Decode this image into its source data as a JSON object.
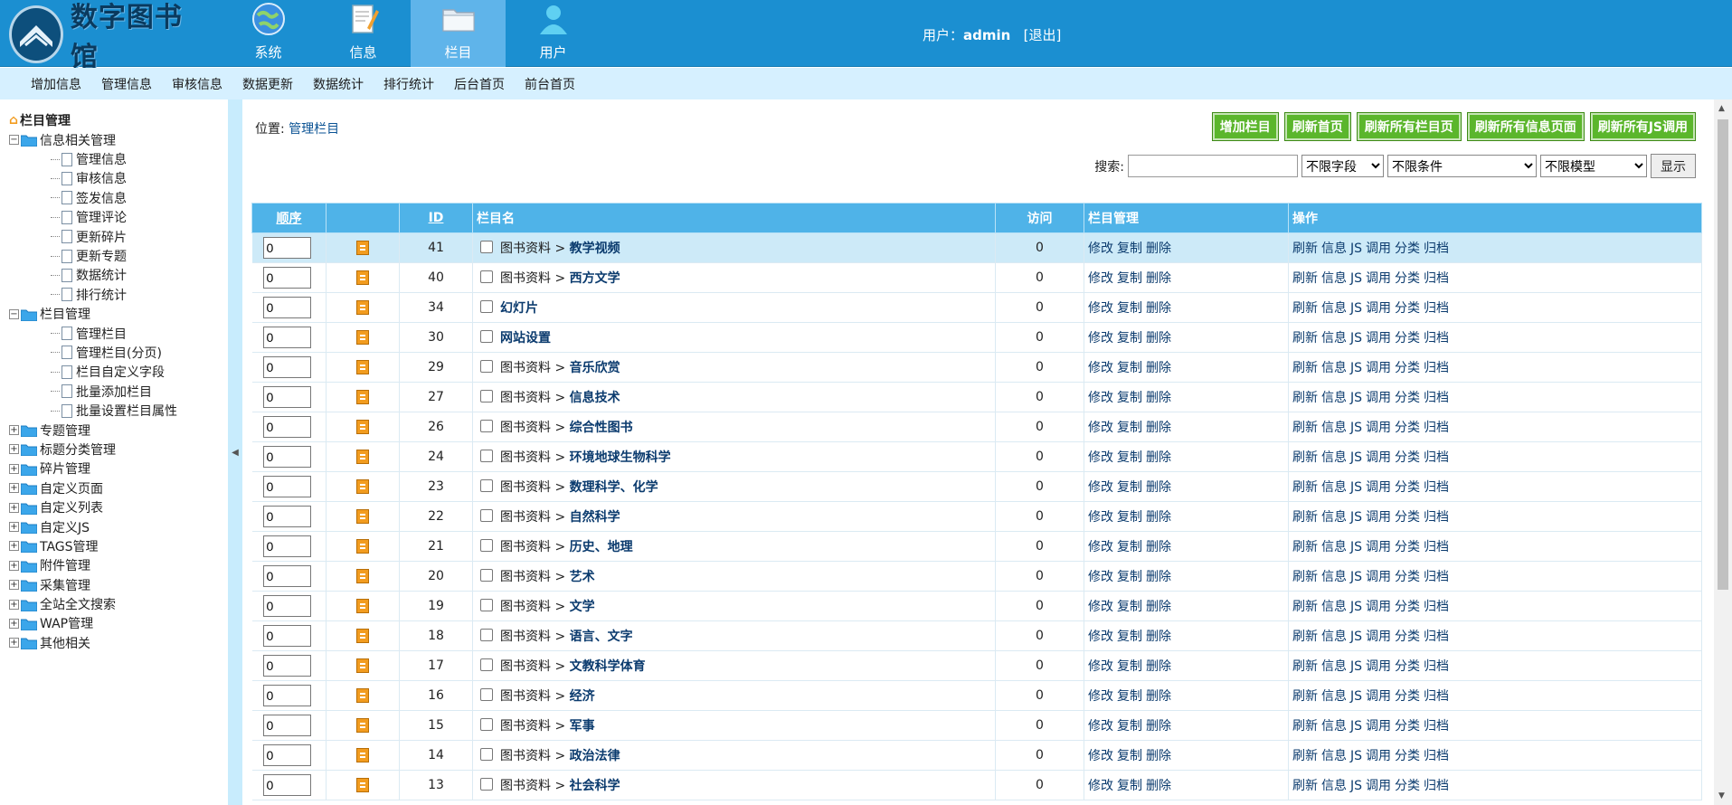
{
  "logo": {
    "title": "数字图书馆"
  },
  "nav": {
    "items": [
      {
        "label": "系统"
      },
      {
        "label": "信息"
      },
      {
        "label": "栏目"
      },
      {
        "label": "用户"
      }
    ]
  },
  "user": {
    "prefix": "用户：",
    "name": "admin",
    "logout": "[退出]"
  },
  "subnav": {
    "items": [
      "增加信息",
      "管理信息",
      "审核信息",
      "数据更新",
      "数据统计",
      "排行统计",
      "后台首页",
      "前台首页"
    ]
  },
  "sidebar": {
    "root": "栏目管理",
    "groups": [
      {
        "label": "信息相关管理",
        "expanded": true,
        "children": [
          "管理信息",
          "审核信息",
          "签发信息",
          "管理评论",
          "更新碎片",
          "更新专题",
          "数据统计",
          "排行统计"
        ]
      },
      {
        "label": "栏目管理",
        "expanded": true,
        "children": [
          "管理栏目",
          "管理栏目(分页)",
          "栏目自定义字段",
          "批量添加栏目",
          "批量设置栏目属性"
        ]
      },
      {
        "label": "专题管理"
      },
      {
        "label": "标题分类管理"
      },
      {
        "label": "碎片管理"
      },
      {
        "label": "自定义页面"
      },
      {
        "label": "自定义列表"
      },
      {
        "label": "自定义JS"
      },
      {
        "label": "TAGS管理"
      },
      {
        "label": "附件管理"
      },
      {
        "label": "采集管理"
      },
      {
        "label": "全站全文搜索"
      },
      {
        "label": "WAP管理"
      },
      {
        "label": "其他相关"
      }
    ]
  },
  "position": {
    "label": "位置:",
    "link": "管理栏目"
  },
  "actions": [
    "增加栏目",
    "刷新首页",
    "刷新所有栏目页",
    "刷新所有信息页面",
    "刷新所有JS调用"
  ],
  "search": {
    "label": "搜索:",
    "value": "",
    "field_select": "不限字段",
    "cond_select": "不限条件",
    "model_select": "不限模型",
    "show_button": "显示"
  },
  "table": {
    "headers": {
      "order": "顺序",
      "id": "ID",
      "name": "栏目名",
      "visits": "访问",
      "manage": "栏目管理",
      "ops": "操作"
    },
    "manage_links": [
      "修改",
      "复制",
      "删除"
    ],
    "op_links": [
      "刷新",
      "信息",
      "JS",
      "调用",
      "分类",
      "归档"
    ],
    "rows": [
      {
        "order": "0",
        "id": "41",
        "parent": "图书资料",
        "name": "教学视频",
        "visits": "0"
      },
      {
        "order": "0",
        "id": "40",
        "parent": "图书资料",
        "name": "西方文学",
        "visits": "0"
      },
      {
        "order": "0",
        "id": "34",
        "parent": "",
        "name": "幻灯片",
        "visits": "0"
      },
      {
        "order": "0",
        "id": "30",
        "parent": "",
        "name": "网站设置",
        "visits": "0"
      },
      {
        "order": "0",
        "id": "29",
        "parent": "图书资料",
        "name": "音乐欣赏",
        "visits": "0"
      },
      {
        "order": "0",
        "id": "27",
        "parent": "图书资料",
        "name": "信息技术",
        "visits": "0"
      },
      {
        "order": "0",
        "id": "26",
        "parent": "图书资料",
        "name": "综合性图书",
        "visits": "0"
      },
      {
        "order": "0",
        "id": "24",
        "parent": "图书资料",
        "name": "环境地球生物科学",
        "visits": "0"
      },
      {
        "order": "0",
        "id": "23",
        "parent": "图书资料",
        "name": "数理科学、化学",
        "visits": "0"
      },
      {
        "order": "0",
        "id": "22",
        "parent": "图书资料",
        "name": "自然科学",
        "visits": "0"
      },
      {
        "order": "0",
        "id": "21",
        "parent": "图书资料",
        "name": "历史、地理",
        "visits": "0"
      },
      {
        "order": "0",
        "id": "20",
        "parent": "图书资料",
        "name": "艺术",
        "visits": "0"
      },
      {
        "order": "0",
        "id": "19",
        "parent": "图书资料",
        "name": "文学",
        "visits": "0"
      },
      {
        "order": "0",
        "id": "18",
        "parent": "图书资料",
        "name": "语言、文字",
        "visits": "0"
      },
      {
        "order": "0",
        "id": "17",
        "parent": "图书资料",
        "name": "文教科学体育",
        "visits": "0"
      },
      {
        "order": "0",
        "id": "16",
        "parent": "图书资料",
        "name": "经济",
        "visits": "0"
      },
      {
        "order": "0",
        "id": "15",
        "parent": "图书资料",
        "name": "军事",
        "visits": "0"
      },
      {
        "order": "0",
        "id": "14",
        "parent": "图书资料",
        "name": "政治法律",
        "visits": "0"
      },
      {
        "order": "0",
        "id": "13",
        "parent": "图书资料",
        "name": "社会科学",
        "visits": "0"
      }
    ]
  },
  "colors": {
    "header_bg": "#1b8fd1",
    "subnav_bg": "#d6f0ff",
    "table_head": "#4fb3e8",
    "action_btn": "#5bb62c"
  }
}
